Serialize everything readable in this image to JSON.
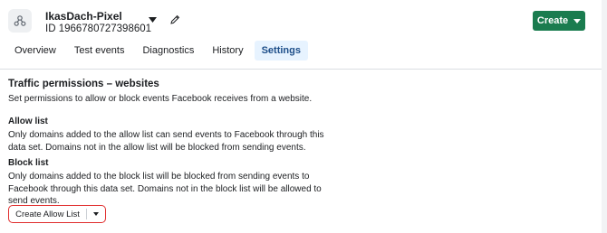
{
  "pixel": {
    "name": "IkasDach-Pixel",
    "id_text": "ID 1966780727398601"
  },
  "header": {
    "create_label": "Create"
  },
  "tabs": [
    {
      "label": "Overview",
      "active": false
    },
    {
      "label": "Test events",
      "active": false
    },
    {
      "label": "Diagnostics",
      "active": false
    },
    {
      "label": "History",
      "active": false
    },
    {
      "label": "Settings",
      "active": true
    }
  ],
  "traffic": {
    "title": "Traffic permissions – websites",
    "description": "Set permissions to allow or block events Facebook receives from a website."
  },
  "allow_list": {
    "title": "Allow list",
    "description": "Only domains added to the allow list can send events to Facebook through this data set. Domains not in the allow list will be blocked from sending events."
  },
  "block_list": {
    "title": "Block list",
    "description": "Only domains added to the block list will be blocked from sending events to Facebook through this data set. Domains not in the block list will be allowed to send events."
  },
  "actions": {
    "create_allow_list_label": "Create Allow List"
  },
  "colors": {
    "brand_green": "#1a7c4f",
    "tab_active_bg": "#e7f3ff",
    "highlight_red": "#e02d2d"
  }
}
